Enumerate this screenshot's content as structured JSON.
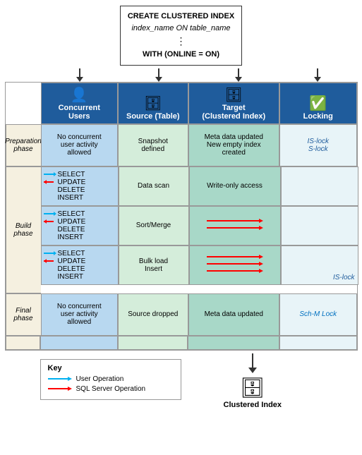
{
  "sql": {
    "line1": "CREATE CLUSTERED INDEX",
    "line2": "index_name ON table_name",
    "dots": "⋮",
    "line3": "WITH (ONLINE = ON)"
  },
  "columns": {
    "concurrent": {
      "label": "Concurrent\nUsers",
      "icon": "👤"
    },
    "source": {
      "label": "Source (Table)",
      "icon": "🗄"
    },
    "target": {
      "label": "Target\n(Clustered Index)",
      "icon": "🗄"
    },
    "locking": {
      "label": "Locking",
      "icon": "✅"
    }
  },
  "phases": {
    "preparation": {
      "label": "Preparation\nphase",
      "concurrent": "No concurrent\nuser activity\nallowed",
      "source": "Snapshot\ndefined",
      "target": "Meta data updated\nNew empty index\ncreated",
      "locking": "IS-lock\nS-lock"
    },
    "build": {
      "label": "Build\nphase",
      "subrows": [
        {
          "ops": "SELECT\nUPDATE\nDELETE\nINSERT",
          "source": "Data scan",
          "target": "Write-only access",
          "locking": ""
        },
        {
          "ops": "SELECT\nUPDATE\nDELETE\nINSERT",
          "source": "Sort/Merge",
          "target": "",
          "locking": ""
        },
        {
          "ops": "SELECT\nUPDATE\nDELETE\nINSERT",
          "source": "Bulk load\nInsert",
          "target": "",
          "locking": "IS-lock"
        }
      ]
    },
    "final": {
      "label": "Final\nphase",
      "concurrent": "No concurrent\nuser activity\nallowed",
      "source": "Source dropped",
      "target": "Meta data updated",
      "locking": "Sch-M Lock"
    }
  },
  "key": {
    "title": "Key",
    "items": [
      {
        "label": "User Operation",
        "color": "cyan"
      },
      {
        "label": "SQL Server Operation",
        "color": "red"
      }
    ]
  },
  "bottom": {
    "label": "Clustered Index"
  }
}
